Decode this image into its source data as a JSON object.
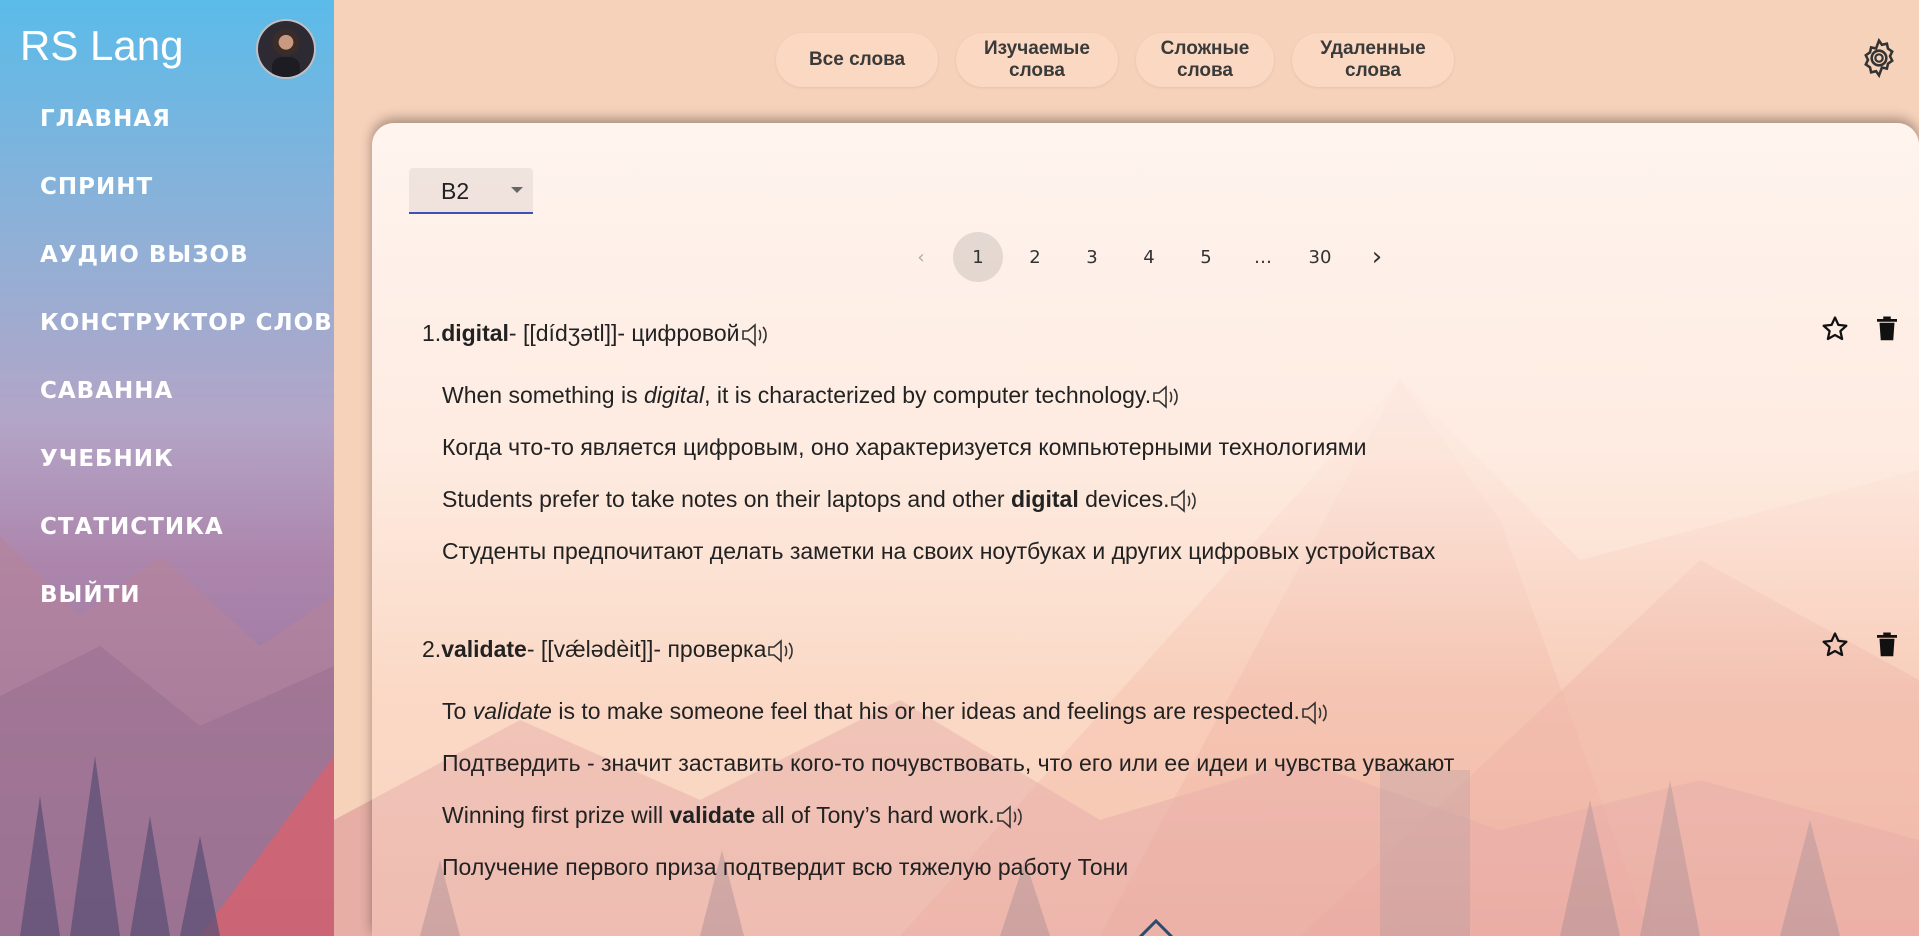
{
  "app": {
    "title": "RS Lang"
  },
  "nav": [
    {
      "label": "ГЛАВНАЯ"
    },
    {
      "label": "СПРИНТ"
    },
    {
      "label": "АУДИО ВЫЗОВ"
    },
    {
      "label": "КОНСТРУКТОР СЛОВ"
    },
    {
      "label": "САВАННА"
    },
    {
      "label": "УЧЕБНИК"
    },
    {
      "label": "СТАТИСТИКА"
    },
    {
      "label": "ВЫЙТИ"
    }
  ],
  "tabs": [
    {
      "label": "Все слова"
    },
    {
      "label": "Изучаемые слова"
    },
    {
      "label": "Сложные слова"
    },
    {
      "label": "Удаленные слова"
    }
  ],
  "level_select": {
    "value": "B2"
  },
  "pagination": {
    "prev": "‹",
    "next": "›",
    "pages": [
      "1",
      "2",
      "3",
      "4",
      "5",
      "…",
      "30"
    ],
    "current": "1"
  },
  "words": [
    {
      "index": "1.",
      "word": "digital",
      "sep1": "- ",
      "transcription": "[[dídʒətl]]",
      "sep2": "- ",
      "translation": "цифровой",
      "meaning_pre": "When something is ",
      "meaning_word": "digital",
      "meaning_post": ", it is characterized by computer technology.",
      "meaning_translate": "Когда что-то является цифровым, оно характеризуется компьютерными технологиями",
      "example_pre": "Students prefer to take notes on their laptops and other ",
      "example_word": "digital",
      "example_post": " devices.",
      "example_translate": "Студенты предпочитают делать заметки на своих ноутбуках и других цифровых устройствах"
    },
    {
      "index": "2.",
      "word": "validate",
      "sep1": "- ",
      "transcription": "[[vǽlədèit]]",
      "sep2": "- ",
      "translation": "проверка",
      "meaning_pre": "To ",
      "meaning_word": "validate",
      "meaning_post": " is to make someone feel that his or her ideas and feelings are respected.",
      "meaning_translate": "Подтвердить - значит заставить кого-то почувствовать, что его или ее идеи и чувства уважают",
      "example_pre": "Winning first prize will ",
      "example_word": "validate",
      "example_post": " all of Tony’s hard work.",
      "example_translate": "Получение первого приза подтвердит всю тяжелую работу Тони"
    }
  ],
  "icons": {
    "settings": "gear-icon",
    "star": "star-icon",
    "trash": "trash-icon",
    "audio": "speaker-icon",
    "avatar": "avatar"
  },
  "colors": {
    "sidebar_top": "#5bbbe9",
    "background": "#f7d2bb",
    "select_underline": "#3f51b5"
  }
}
